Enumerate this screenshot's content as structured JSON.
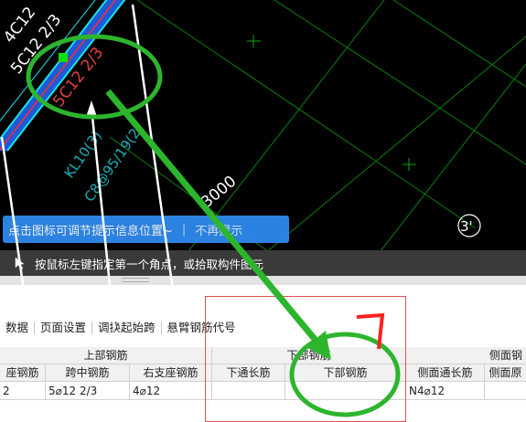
{
  "canvas": {
    "beam_label_1": "4C12",
    "beam_label_2": "5C12 2/3",
    "beam_label_3": "5C12 2/3",
    "beam_label_4": "KL10(3)",
    "beam_label_5": "C8@95/19(2)",
    "dimension": "3000",
    "axis_marker": "3'"
  },
  "hint": {
    "text": "点击图标可调节提示信息位置~",
    "separator": "|",
    "dismiss": "不再提示"
  },
  "status": {
    "message": "按鼠标左键指定第一个角点，或拾取构件图元"
  },
  "toolbar": {
    "items": [
      "数据",
      "页面设置",
      "调换起始跨",
      "悬臂钢筋代号"
    ]
  },
  "grid": {
    "group_top": "上部钢筋",
    "group_bottom": "下部钢筋",
    "group_side": "侧面钢",
    "headers": [
      "座钢筋",
      "跨中钢筋",
      "右支座钢筋",
      "下通长筋",
      "下部钢筋",
      "侧面通长筋",
      "侧面原"
    ],
    "row": [
      "2",
      "5⌀12 2/3",
      "4⌀12",
      "",
      "",
      "N4⌀12",
      ""
    ]
  },
  "colors": {
    "beam_fill": "#1e5ad8",
    "beam_edge": "#19e3e6",
    "beam_center": "#ff2a2a",
    "grid_line": "#0fa80f",
    "annotation": "#2db52d",
    "hint_bg": "#2f8ef3"
  }
}
